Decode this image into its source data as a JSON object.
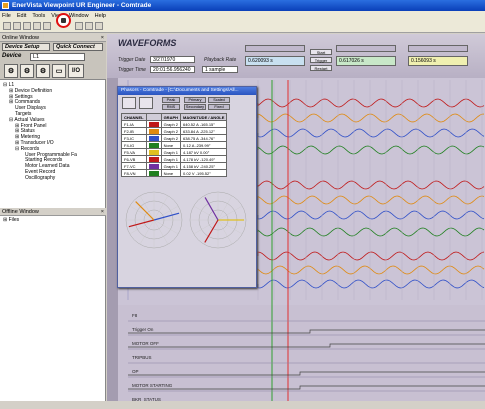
{
  "app": {
    "title": "EnerVista Viewpoint UR Engineer - Comtrade"
  },
  "menu": [
    "File",
    "Edit",
    "Tools",
    "View",
    "Window",
    "Help"
  ],
  "left": {
    "online_header": "Online Window",
    "device_setup": "Device Setup",
    "quick_connect": "Quick Connect",
    "device_label": "Device",
    "device_value": "L1",
    "io_label": "I/O",
    "tree": [
      "L1",
      "Device Definition",
      "Settings",
      "Commands",
      "User Displays",
      "Targets",
      "Actual Values",
      "Front Panel",
      "Status",
      "Metering",
      "Transducer I/O",
      "Records",
      "User Programmable Fa",
      "Starting Records",
      "Motor Learned Data",
      "Event Record",
      "Oscillography"
    ],
    "offline_header": "Offline Window",
    "offline_tree": [
      "Files"
    ]
  },
  "waveforms": {
    "title": "WAVEFORMS",
    "trigger_date_label": "Trigger Date",
    "trigger_date": "3/27/1970",
    "trigger_time_label": "Trigger Time",
    "trigger_time": "20:01:56.956240",
    "playback_label": "Playback Rate",
    "playback_value": "1 sample",
    "cursor1": "0.620093 s",
    "cursor2": "0.617026 s",
    "cursor3": "0.156093 s",
    "start_btn": "Start",
    "trigger_btn": "Trigger",
    "restart_btn": "Restart"
  },
  "phasor": {
    "title": "Phasors - Comtrade - [C:\\Documents and Settings\\All...",
    "tab_peak": "Peak",
    "tab_rms": "RMS",
    "tab_primary": "Primary",
    "tab_secondary": "Secondary",
    "tab_scaled": "Scaled",
    "tab_fixed": "Fixed",
    "headers": [
      "CHANNEL",
      "",
      "GRAPH",
      "MAGNITUDE / ANGLE"
    ],
    "rows": [
      {
        "ch": "F1-IA",
        "color": "#c01818",
        "graph": "Graph 2",
        "mag": "640.52 A  -165.15°"
      },
      {
        "ch": "F2-IB",
        "color": "#e08a10",
        "graph": "Graph 2",
        "mag": "633.84 A  -225.12°"
      },
      {
        "ch": "F3-IC",
        "color": "#3050c8",
        "graph": "Graph 2",
        "mag": "638.75 A  -344.76°"
      },
      {
        "ch": "F4-IG",
        "color": "#208020",
        "graph": "None",
        "mag": "0.12 A  -239.99°"
      },
      {
        "ch": "F5-VA",
        "color": "#e0c020",
        "graph": "Graph 1",
        "mag": "4.187 kV  0.00°"
      },
      {
        "ch": "F6-VB",
        "color": "#c01818",
        "graph": "Graph 1",
        "mag": "4.178 kV  -120.49°"
      },
      {
        "ch": "F7-VC",
        "color": "#7030a0",
        "graph": "Graph 1",
        "mag": "4.158 kV  -240.25°"
      },
      {
        "ch": "F8-VN",
        "color": "#208020",
        "graph": "None",
        "mag": "0.02 V  -195.52°"
      }
    ]
  },
  "signals": [
    "F8",
    "Trigger On",
    "MOTOR OFF",
    "TRIPBUS",
    "OP",
    "MOTOR STARTING",
    "BKR_STATUS"
  ],
  "colors": {
    "accent": "#2a6fe0",
    "red": "#c01818",
    "orange": "#e08a10",
    "blue": "#3050c8",
    "green": "#208020",
    "cursor_red": "#e03030",
    "cursor_green": "#30a030"
  }
}
